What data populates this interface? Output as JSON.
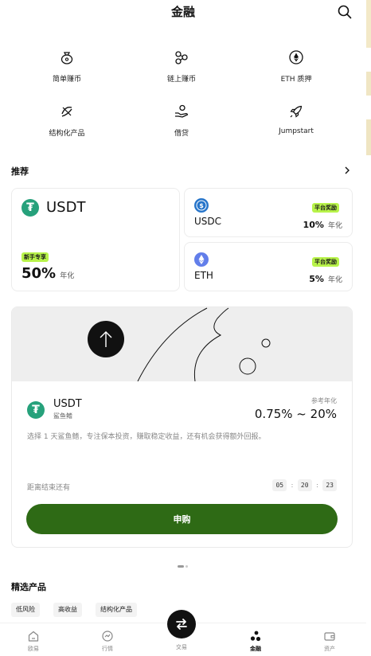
{
  "header": {
    "title": "金融",
    "search_icon": "search-icon"
  },
  "services": [
    {
      "label": "简单赚币",
      "icon": "money-bag-icon"
    },
    {
      "label": "链上赚币",
      "icon": "chain-nodes-icon"
    },
    {
      "label": "ETH 质押",
      "icon": "eth-stake-icon"
    },
    {
      "label": "结构化产品",
      "icon": "structured-icon"
    },
    {
      "label": "借贷",
      "icon": "loan-hand-icon"
    },
    {
      "label": "Jumpstart",
      "icon": "rocket-icon"
    }
  ],
  "recommend": {
    "title": "推荐",
    "main_card": {
      "coin": "USDT",
      "badge": "新手专享",
      "rate": "50%",
      "unit": "年化"
    },
    "side_cards": [
      {
        "coin": "USDC",
        "badge": "平台奖励",
        "rate": "10%",
        "unit": "年化",
        "icon_color": "#2775ca"
      },
      {
        "coin": "ETH",
        "badge": "平台奖励",
        "rate": "5%",
        "unit": "年化",
        "icon_color": "#627eea"
      }
    ]
  },
  "featured": {
    "coin": "USDT",
    "subtitle": "鲨鱼鳍",
    "rate_label": "参考年化",
    "rate": "0.75% ~ 20%",
    "description": "选择 1 天鲨鱼鳍，专注保本投资，赚取稳定收益，还有机会获得额外回报。",
    "countdown_label": "距离结束还有",
    "countdown": {
      "hours": "05",
      "minutes": "20",
      "seconds": "23",
      "sep": ":"
    },
    "button": "申购"
  },
  "selected": {
    "title": "精选产品",
    "chips": [
      "低风险",
      "高收益",
      "结构化产品"
    ]
  },
  "tabbar": {
    "items": [
      {
        "label": "欧易",
        "icon": "home-icon"
      },
      {
        "label": "行情",
        "icon": "market-icon"
      },
      {
        "label": "交易",
        "icon": "trade-icon"
      },
      {
        "label": "金融",
        "icon": "finance-icon",
        "active": true
      },
      {
        "label": "资产",
        "icon": "wallet-icon"
      }
    ]
  },
  "colors": {
    "accent_green": "#2e6a15",
    "badge_lime": "#b8f34a",
    "usdt": "#26a17b"
  }
}
